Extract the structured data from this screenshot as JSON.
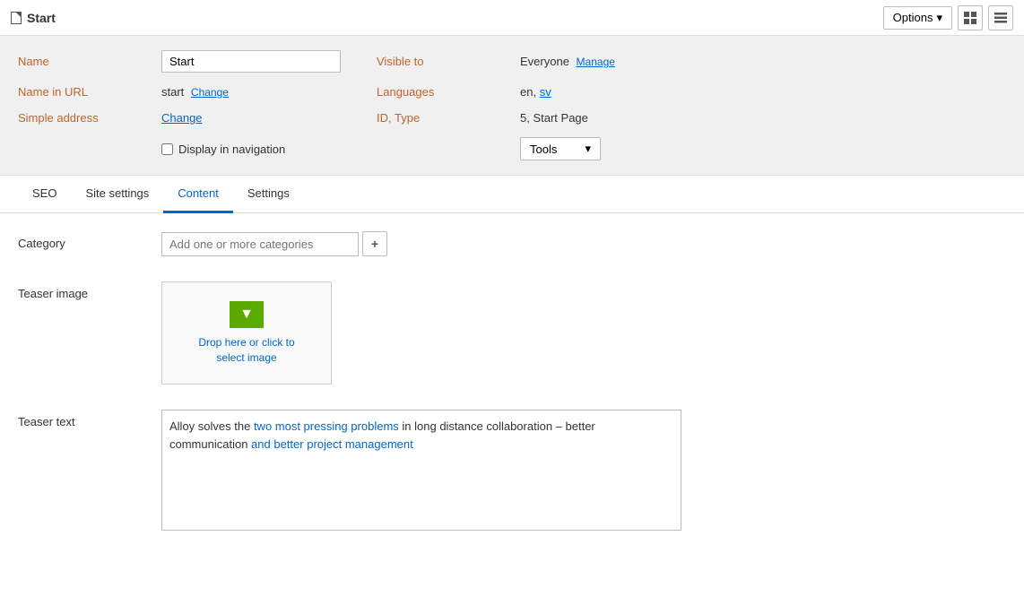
{
  "topbar": {
    "title": "Start",
    "options_label": "Options",
    "options_chevron": "▾"
  },
  "properties": {
    "name_label": "Name",
    "name_value": "Start",
    "name_in_url_label": "Name in URL",
    "name_in_url_value": "start",
    "name_in_url_change": "Change",
    "simple_address_label": "Simple address",
    "simple_address_change": "Change",
    "display_nav_label": "Display in navigation",
    "visible_to_label": "Visible to",
    "visible_to_value": "Everyone",
    "manage_link": "Manage",
    "languages_label": "Languages",
    "languages_value": "en, ",
    "languages_sv": "sv",
    "id_type_label": "ID, Type",
    "id_type_value": "5, Start Page",
    "tools_label": "Tools",
    "tools_chevron": "▾"
  },
  "tabs": [
    {
      "id": "seo",
      "label": "SEO"
    },
    {
      "id": "site-settings",
      "label": "Site settings"
    },
    {
      "id": "content",
      "label": "Content"
    },
    {
      "id": "settings",
      "label": "Settings"
    }
  ],
  "active_tab": "content",
  "content": {
    "category_label": "Category",
    "category_placeholder": "Add one or more categories",
    "add_btn_label": "+",
    "teaser_image_label": "Teaser image",
    "drop_text": "Drop here or click to\nselect image",
    "teaser_text_label": "Teaser text",
    "teaser_text_plain": "Alloy solves the ",
    "teaser_text_highlight1": "two most pressing problems",
    "teaser_text_mid1": " in long distance collaboration – better\ncommunication",
    "teaser_text_highlight2": " and better ",
    "teaser_text_highlight3": "project management",
    "teaser_text_full": "Alloy solves the two most pressing problems in long distance collaboration – better communication and better project management"
  }
}
